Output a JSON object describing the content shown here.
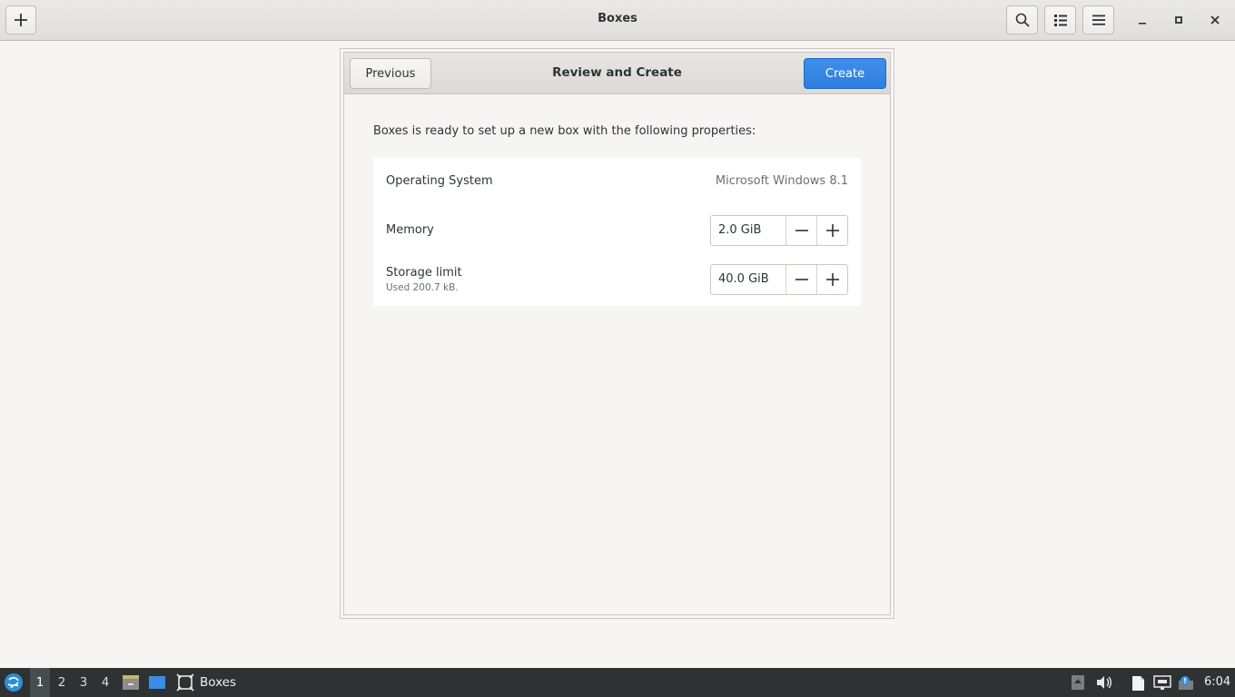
{
  "window": {
    "title": "Boxes",
    "buttons": {
      "new_icon": "plus-icon",
      "search_icon": "search-icon",
      "view_icon": "list-view-icon",
      "menu_icon": "hamburger-menu-icon",
      "minimize_icon": "minimize-icon",
      "maximize_icon": "maximize-icon",
      "close_icon": "close-icon"
    }
  },
  "dialog": {
    "title": "Review and Create",
    "previous_label": "Previous",
    "create_label": "Create",
    "intro": "Boxes is ready to set up a new box with the following properties:",
    "properties": {
      "os": {
        "label": "Operating System",
        "value": "Microsoft Windows 8.1"
      },
      "memory": {
        "label": "Memory",
        "value": "2.0 GiB"
      },
      "storage": {
        "label": "Storage limit",
        "sublabel": "Used 200.7 kB.",
        "value": "40.0 GiB"
      }
    }
  },
  "taskbar": {
    "workspaces": [
      "1",
      "2",
      "3",
      "4"
    ],
    "active_workspace": "1",
    "app_label": "Boxes",
    "clock": "6:04"
  },
  "colors": {
    "accent": "#3584e4",
    "taskbar_bg": "#2e3233",
    "window_bg": "#f6f5f4"
  }
}
